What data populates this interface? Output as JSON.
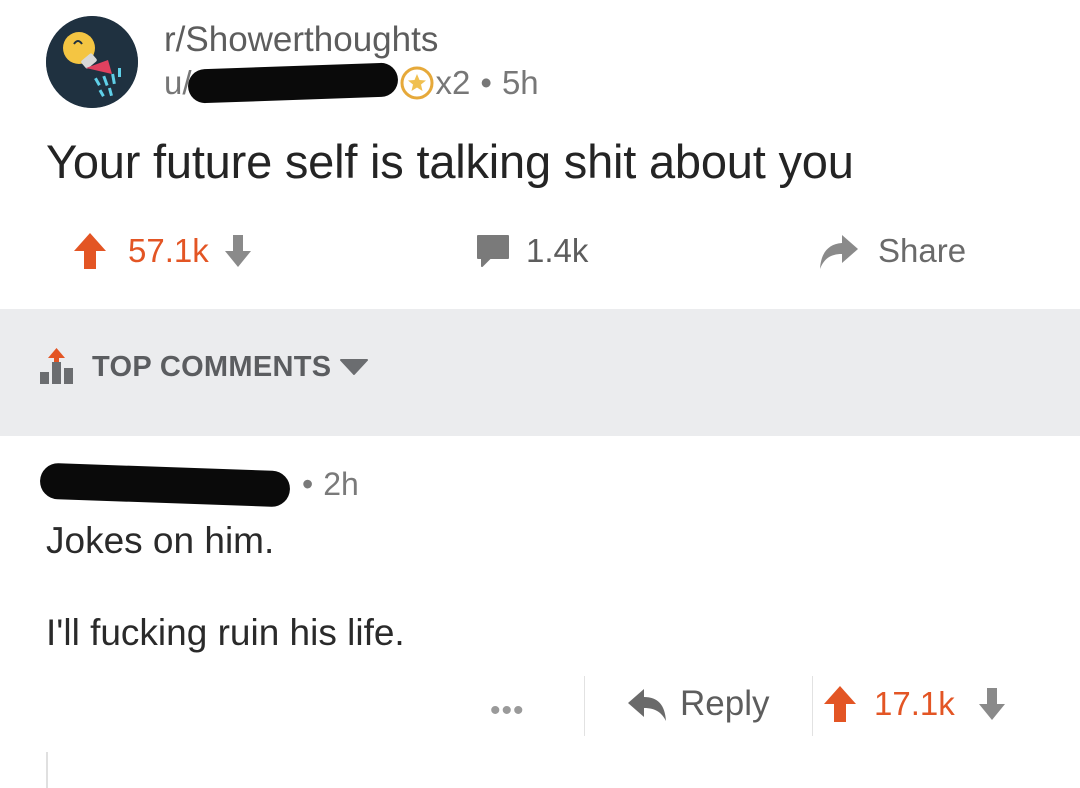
{
  "post": {
    "subreddit": "r/Showerthoughts",
    "user_prefix": "u/",
    "award_count": "x2",
    "separator": "•",
    "age": "5h",
    "title": "Your future self is talking shit about you",
    "upvotes": "57.1k",
    "comments": "1.4k",
    "share_label": "Share"
  },
  "comments_section": {
    "sort_label": "TOP COMMENTS"
  },
  "comment": {
    "separator": "•",
    "age": "2h",
    "line1": "Jokes on him.",
    "line2": "I'll fucking ruin his life.",
    "more_label": "•••",
    "reply_label": "Reply",
    "upvotes": "17.1k"
  },
  "colors": {
    "upvote": "#e35524",
    "band": "#ebecee",
    "avatar_bg": "#1f3140"
  },
  "icons": [
    "showerthoughts-avatar-icon",
    "award-icon",
    "upvote-icon",
    "downvote-icon",
    "comment-icon",
    "share-icon",
    "top-comments-icon",
    "chevron-down-icon",
    "reply-icon"
  ]
}
